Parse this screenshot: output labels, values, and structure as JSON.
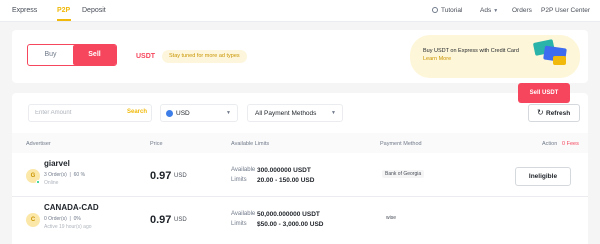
{
  "nav": {
    "tabs": [
      "Express",
      "P2P",
      "Deposit"
    ],
    "tutorial": "Tutorial",
    "ads": "Ads",
    "orders": "Orders",
    "user_center": "P2P User Center"
  },
  "hero": {
    "buy": "Buy",
    "sell": "Sell",
    "coin": "USDT",
    "hint": "Stay tuned for more ad types",
    "promo_text": "Buy USDT on Express with Credit Card",
    "promo_link": "Learn More"
  },
  "filters": {
    "amount_placeholder": "Enter Amount",
    "search": "Search",
    "currency": "USD",
    "payment": "All Payment Methods",
    "refresh": "Refresh"
  },
  "table": {
    "headers": {
      "advertiser": "Advertiser",
      "price": "Price",
      "available_limits": "Available   Limits",
      "payment": "Payment Method",
      "action": "Action",
      "fee": "0 Fees"
    },
    "rows": [
      {
        "initial": "G",
        "name": "giarvel",
        "orders": "3 Order(s)",
        "completion": "60 %",
        "status": "Online",
        "price": "0.97",
        "price_currency": "USD",
        "available_label": "Available",
        "available": "300.000000 USDT",
        "limits_label": "Limits",
        "limits": "20.00 - 150.00 USD",
        "payment": "Bank of Georgia",
        "action": "Ineligible"
      },
      {
        "initial": "C",
        "name": "CANADA-CAD",
        "orders": "0 Order(s)",
        "completion": "0%",
        "status": "Active 19 hour(s) ago",
        "price": "0.97",
        "price_currency": "USD",
        "available_label": "Available",
        "available": "50,000.000000 USDT",
        "limits_label": "Limits",
        "limits": "$50.00 - 3,000.00 USD",
        "payment": "wise",
        "action": "Sell USDT"
      }
    ]
  },
  "colors": {
    "accent": "#f0b90b",
    "sell": "#f6465d",
    "online": "#0ecb81"
  }
}
